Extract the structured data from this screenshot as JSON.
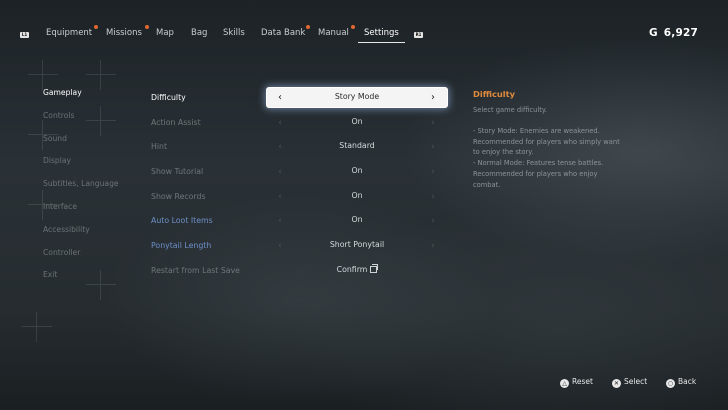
{
  "top_bar": {
    "left_shoulder": "L1",
    "right_shoulder": "R1",
    "tabs": [
      {
        "label": "Equipment",
        "badge": true
      },
      {
        "label": "Missions",
        "badge": true
      },
      {
        "label": "Map",
        "badge": false
      },
      {
        "label": "Bag",
        "badge": false
      },
      {
        "label": "Skills",
        "badge": false
      },
      {
        "label": "Data Bank",
        "badge": true
      },
      {
        "label": "Manual",
        "badge": true
      },
      {
        "label": "Settings",
        "badge": false,
        "active": true
      }
    ],
    "currency_symbol": "G",
    "currency_amount": "6,927"
  },
  "sidebar": {
    "items": [
      {
        "label": "Gameplay",
        "active": true
      },
      {
        "label": "Controls"
      },
      {
        "label": "Sound"
      },
      {
        "label": "Display"
      },
      {
        "label": "Subtitles, Language"
      },
      {
        "label": "Interface"
      },
      {
        "label": "Accessibility"
      },
      {
        "label": "Controller"
      },
      {
        "label": "Exit"
      }
    ]
  },
  "settings": [
    {
      "label": "Difficulty",
      "value": "Story Mode",
      "active": true
    },
    {
      "label": "Action Assist",
      "value": "On"
    },
    {
      "label": "Hint",
      "value": "Standard"
    },
    {
      "label": "Show Tutorial",
      "value": "On"
    },
    {
      "label": "Show Records",
      "value": "On"
    },
    {
      "label": "Auto Loot Items",
      "value": "On",
      "highlight": "blue"
    },
    {
      "label": "Ponytail Length",
      "value": "Short Ponytail",
      "highlight": "blue"
    },
    {
      "label": "Restart from Last Save",
      "value": "Confirm"
    }
  ],
  "arrows": {
    "left": "‹",
    "right": "›"
  },
  "description": {
    "title": "Difficulty",
    "subtitle": "Select game difficulty.",
    "body": "- Story Mode: Enemies are weakened.\nRecommended for players who simply want\nto enjoy the story.\n- Normal Mode: Features tense battles.\nRecommended for players who enjoy\ncombat."
  },
  "bottom_hints": {
    "reset": {
      "icon": "△",
      "label": "Reset"
    },
    "select": {
      "icon": "✕",
      "label": "Select"
    },
    "back": {
      "icon": "○",
      "label": "Back"
    }
  },
  "colors": {
    "accent_orange": "#e08a3c",
    "badge_orange": "#e0672f",
    "blue_label": "#6d8fc9"
  }
}
